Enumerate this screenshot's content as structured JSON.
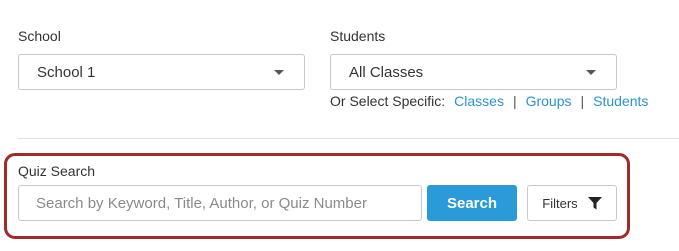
{
  "school": {
    "label": "School",
    "selected": "School 1"
  },
  "students": {
    "label": "Students",
    "selected": "All Classes",
    "specific_prefix": "Or Select Specific:",
    "links": [
      "Classes",
      "Groups",
      "Students"
    ],
    "separator": "|"
  },
  "quiz_search": {
    "label": "Quiz Search",
    "placeholder": "Search by Keyword, Title, Author, or Quiz Number",
    "value": "",
    "search_button": "Search",
    "filters_button": "Filters",
    "filter_icon": "funnel-icon"
  },
  "colors": {
    "accent": "#2b9ad8",
    "link": "#2b93d1",
    "highlight_border": "#a12a2a"
  }
}
